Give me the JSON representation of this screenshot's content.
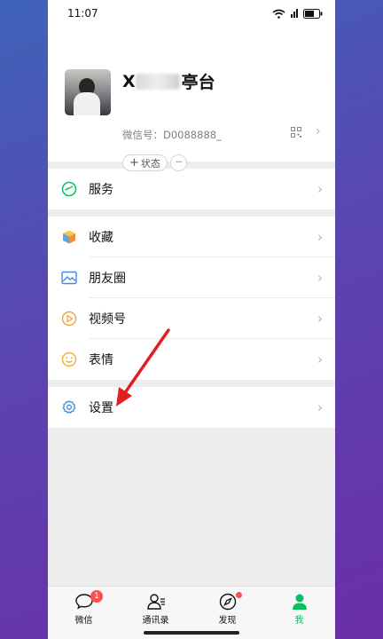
{
  "status_bar": {
    "time": "11:07"
  },
  "profile": {
    "nickname_suffix": "亭台",
    "nickname_prefix": "X",
    "wechat_id": "微信号：D0088888_",
    "status_label": "状态",
    "more_label": "···"
  },
  "menu": {
    "services": "服务",
    "favorites": "收藏",
    "moments": "朋友圈",
    "channels": "视频号",
    "stickers": "表情",
    "settings": "设置"
  },
  "tabbar": {
    "chats": "微信",
    "chats_badge": "1",
    "contacts": "通讯录",
    "discover": "发现",
    "me": "我"
  },
  "colors": {
    "accent": "#07c160",
    "badge": "#fa5151",
    "annotation_arrow": "#e02020"
  }
}
